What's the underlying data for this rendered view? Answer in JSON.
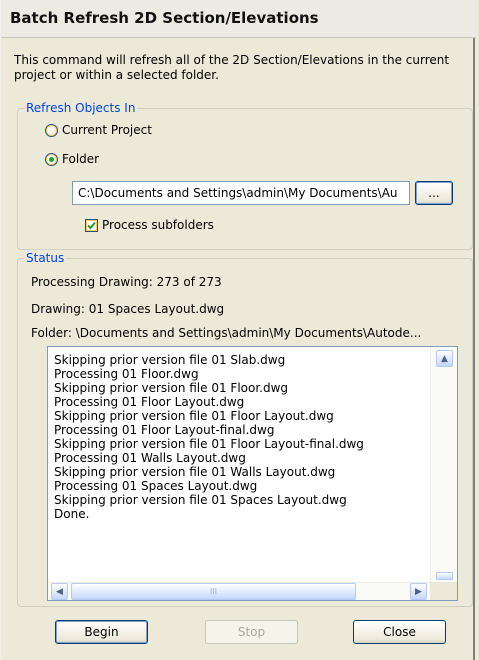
{
  "dialog": {
    "title": "Batch Refresh 2D Section/Elevations",
    "intro": "This command will refresh all of the 2D Section/Elevations in the current project or within a selected folder."
  },
  "refresh_group": {
    "legend": "Refresh Objects In",
    "options": [
      {
        "label": "Current Project",
        "selected": false
      },
      {
        "label": "Folder",
        "selected": true
      }
    ],
    "folder_path": "C:\\Documents and Settings\\admin\\My Documents\\Au",
    "browse_label": "...",
    "process_subfolders": {
      "label": "Process subfolders",
      "checked": true
    }
  },
  "status_group": {
    "legend": "Status",
    "processing": "Processing Drawing: 273 of 273",
    "drawing": "Drawing: 01 Spaces Layout.dwg",
    "folder": "Folder: \\Documents and Settings\\admin\\My Documents\\Autode...",
    "log": [
      "Skipping prior version file 01 Slab.dwg",
      "Processing 01 Floor.dwg",
      "Skipping prior version file 01 Floor.dwg",
      "Processing 01 Floor Layout.dwg",
      "Skipping prior version file 01 Floor Layout.dwg",
      "Processing 01 Floor Layout-final.dwg",
      "Skipping prior version file 01 Floor Layout-final.dwg",
      "Processing 01 Walls Layout.dwg",
      "Skipping prior version file 01 Walls Layout.dwg",
      "Processing 01 Spaces Layout.dwg",
      "Skipping prior version file 01 Spaces Layout.dwg",
      "Done."
    ]
  },
  "buttons": {
    "begin": "Begin",
    "stop": "Stop",
    "close": "Close"
  },
  "icons": {
    "scroll_up": "▲",
    "scroll_down": "▼",
    "scroll_left": "◀",
    "scroll_right": "▶",
    "thumb_grip": "III"
  }
}
